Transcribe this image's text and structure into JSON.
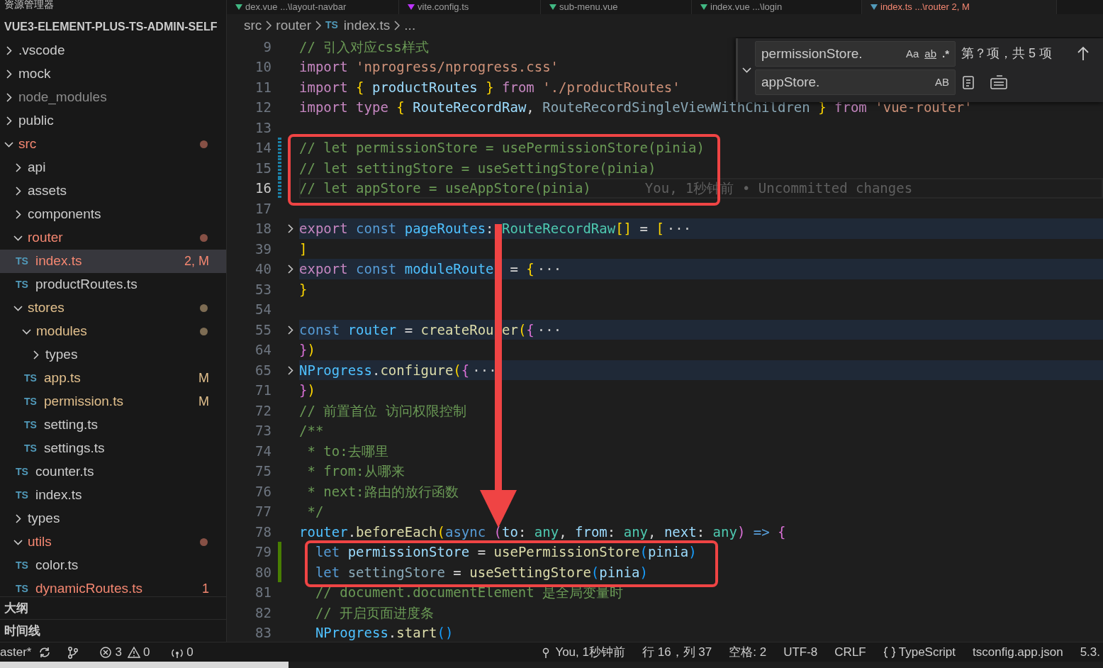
{
  "sidebar": {
    "title": "资源管理器",
    "project": "VUE3-ELEMENT-PLUS-TS-ADMIN-SELF",
    "tree": [
      {
        "label": ".vscode",
        "kind": "folder",
        "expanded": false
      },
      {
        "label": "mock",
        "kind": "folder",
        "expanded": false
      },
      {
        "label": "node_modules",
        "kind": "folder",
        "expanded": false,
        "color": "#8c8c8c"
      },
      {
        "label": "public",
        "kind": "folder",
        "expanded": false
      },
      {
        "label": "src",
        "kind": "folder",
        "expanded": true,
        "color": "#f48771",
        "dot": true,
        "children": [
          {
            "label": "api",
            "kind": "folder",
            "expanded": false
          },
          {
            "label": "assets",
            "kind": "folder",
            "expanded": false
          },
          {
            "label": "components",
            "kind": "folder",
            "expanded": false
          },
          {
            "label": "router",
            "kind": "folder",
            "expanded": true,
            "color": "#f48771",
            "dot": true,
            "children": [
              {
                "label": "index.ts",
                "kind": "file",
                "icon": "TS",
                "color": "#f48771",
                "badge": "2, M",
                "selected": true
              },
              {
                "label": "productRoutes.ts",
                "kind": "file",
                "icon": "TS",
                "selected": false
              }
            ]
          },
          {
            "label": "stores",
            "kind": "folder",
            "expanded": true,
            "color": "#e2c08d",
            "dot": true,
            "children": [
              {
                "label": "modules",
                "kind": "folder",
                "expanded": true,
                "color": "#e2c08d",
                "dot": true,
                "children": [
                  {
                    "label": "types",
                    "kind": "folder",
                    "expanded": false
                  },
                  {
                    "label": "app.ts",
                    "kind": "file",
                    "icon": "TS",
                    "color": "#e2c08d",
                    "badge": "M",
                    "selected": false
                  },
                  {
                    "label": "permission.ts",
                    "kind": "file",
                    "icon": "TS",
                    "color": "#e2c08d",
                    "badge": "M",
                    "selected": false
                  },
                  {
                    "label": "setting.ts",
                    "kind": "file",
                    "icon": "TS",
                    "selected": false
                  },
                  {
                    "label": "settings.ts",
                    "kind": "file",
                    "icon": "TS",
                    "selected": false
                  }
                ]
              },
              {
                "label": "counter.ts",
                "kind": "file",
                "icon": "TS",
                "selected": false
              },
              {
                "label": "index.ts",
                "kind": "file",
                "icon": "TS",
                "selected": false
              }
            ]
          },
          {
            "label": "types",
            "kind": "folder",
            "expanded": false
          },
          {
            "label": "utils",
            "kind": "folder",
            "expanded": true,
            "color": "#f48771",
            "dot": true,
            "children": [
              {
                "label": "color.ts",
                "kind": "file",
                "icon": "TS",
                "selected": false
              },
              {
                "label": "dynamicRoutes.ts",
                "kind": "file",
                "icon": "TS",
                "color": "#f48771",
                "badge": "1",
                "selected": false
              }
            ]
          }
        ]
      }
    ],
    "sections": [
      "大纲",
      "时间线"
    ]
  },
  "tabs": [
    {
      "label": "dex.vue",
      "desc": "...\\layout-navbar",
      "kind": "vue",
      "selected": false
    },
    {
      "label": "vite.config.ts",
      "kind": "vite",
      "selected": false
    },
    {
      "label": "sub-menu.vue",
      "kind": "vue",
      "selected": false
    },
    {
      "label": "index.vue",
      "desc": "...\\login",
      "kind": "vue",
      "selected": false
    },
    {
      "label": "index.ts",
      "desc": "...\\router",
      "badge": "2, M",
      "kind": "ts",
      "selected": true
    }
  ],
  "breadcrumbs": [
    {
      "label": "src"
    },
    {
      "label": "router"
    },
    {
      "label": "index.ts",
      "icon": "TS"
    },
    {
      "label": "..."
    }
  ],
  "find_widget": {
    "expanded": true,
    "find": "permissionStore.",
    "replace": "appStore.",
    "toggles": [
      {
        "label": "Aa",
        "on": false
      },
      {
        "label": "ab",
        "on": false
      },
      {
        "label": ".*",
        "on": false
      }
    ],
    "result": "第？项，共 5 项",
    "preserve_case": {
      "label": "AB",
      "on": false
    }
  },
  "lines": [
    {
      "num": "9",
      "tokens": [
        {
          "text": "// 引入对应css样式",
          "kind": "cmt"
        }
      ]
    },
    {
      "num": "10",
      "tokens": [
        {
          "text": "import ",
          "kind": "kw"
        },
        {
          "text": "'nprogress/nprogress.css'",
          "kind": "str"
        }
      ]
    },
    {
      "num": "11",
      "tokens": [
        {
          "text": "import ",
          "kind": "kw"
        },
        {
          "text": "{",
          "kind": "b1"
        },
        {
          "text": " productRoutes ",
          "kind": "var"
        },
        {
          "text": "}",
          "kind": "b1"
        },
        {
          "text": " from ",
          "kind": "kw"
        },
        {
          "text": "'./productRoutes'",
          "kind": "str"
        }
      ]
    },
    {
      "num": "12",
      "tokens": [
        {
          "text": "import ",
          "kind": "kw"
        },
        {
          "text": "type ",
          "kind": "kw"
        },
        {
          "text": "{",
          "kind": "b1"
        },
        {
          "text": " RouteRecordRaw",
          "kind": "var"
        },
        {
          "text": ", ",
          "kind": "p"
        },
        {
          "text": "RouteRecordSingleViewWithChildren ",
          "kind": "unused"
        },
        {
          "text": "}",
          "kind": "b1"
        },
        {
          "text": " from ",
          "kind": "kw"
        },
        {
          "text": "'vue-router'",
          "kind": "str"
        }
      ]
    },
    {
      "num": "13"
    },
    {
      "num": "14",
      "kind": "modified",
      "tokens": [
        {
          "text": "// let permissionStore = usePermissionStore(pinia)",
          "kind": "cmt"
        }
      ]
    },
    {
      "num": "15",
      "kind": "modified",
      "tokens": [
        {
          "text": "// let settingStore = useSettingStore(pinia)",
          "kind": "cmt"
        }
      ]
    },
    {
      "num": "16",
      "kind": "modified",
      "current": true,
      "tokens": [
        {
          "text": "// let appStore = useAppStore(pinia)",
          "kind": "cmt"
        }
      ],
      "blame": "You, 1秒钟前 • Uncommitted changes"
    },
    {
      "num": "17"
    },
    {
      "num": "18",
      "folded": true,
      "tokens": [
        {
          "text": "export ",
          "kind": "kw"
        },
        {
          "text": "const ",
          "kind": "st"
        },
        {
          "text": "pageRoutes",
          "kind": "cvar"
        },
        {
          "text": ": ",
          "kind": "p"
        },
        {
          "text": "RouteRecordRaw",
          "kind": "typ"
        },
        {
          "text": "[]",
          "kind": "b1"
        },
        {
          "text": " = ",
          "kind": "p"
        },
        {
          "text": "[",
          "kind": "b1"
        },
        {
          "text": "···",
          "kind": "fold"
        }
      ]
    },
    {
      "num": "39",
      "tokens": [
        {
          "text": "]",
          "kind": "b1"
        }
      ]
    },
    {
      "num": "40",
      "folded": true,
      "tokens": [
        {
          "text": "export ",
          "kind": "kw"
        },
        {
          "text": "const ",
          "kind": "st"
        },
        {
          "text": "moduleRoute",
          "kind": "cvar"
        },
        {
          "text": "  = ",
          "kind": "p"
        },
        {
          "text": "{",
          "kind": "b1"
        },
        {
          "text": "···",
          "kind": "fold"
        }
      ]
    },
    {
      "num": "53",
      "tokens": [
        {
          "text": "}",
          "kind": "b1"
        }
      ]
    },
    {
      "num": "54"
    },
    {
      "num": "55",
      "folded": true,
      "tokens": [
        {
          "text": "const ",
          "kind": "st"
        },
        {
          "text": "router",
          "kind": "cvar"
        },
        {
          "text": " = ",
          "kind": "p"
        },
        {
          "text": "createRou",
          "kind": "fn"
        },
        {
          "text": " er",
          "kind": "fn"
        },
        {
          "text": "(",
          "kind": "b1"
        },
        {
          "text": "{",
          "kind": "b2"
        },
        {
          "text": "···",
          "kind": "fold"
        }
      ]
    },
    {
      "num": "64",
      "tokens": [
        {
          "text": "}",
          "kind": "b2"
        },
        {
          "text": ")",
          "kind": "b1"
        }
      ]
    },
    {
      "num": "65",
      "folded": true,
      "tokens": [
        {
          "text": "NProgress",
          "kind": "cvar"
        },
        {
          "text": ".",
          "kind": "p"
        },
        {
          "text": "configure",
          "kind": "fn"
        },
        {
          "text": "(",
          "kind": "b1"
        },
        {
          "text": "{",
          "kind": "b2"
        },
        {
          "text": "···",
          "kind": "fold"
        }
      ]
    },
    {
      "num": "71",
      "tokens": [
        {
          "text": "}",
          "kind": "b2"
        },
        {
          "text": ")",
          "kind": "b1"
        }
      ]
    },
    {
      "num": "72",
      "tokens": [
        {
          "text": "// 前置首位 访问权限控制",
          "kind": "cmt"
        }
      ]
    },
    {
      "num": "73",
      "tokens": [
        {
          "text": "/**",
          "kind": "cmt"
        }
      ]
    },
    {
      "num": "74",
      "tokens": [
        {
          "text": " * to:去哪里",
          "kind": "cmt"
        }
      ]
    },
    {
      "num": "75",
      "tokens": [
        {
          "text": " * from:从哪来",
          "kind": "cmt"
        }
      ]
    },
    {
      "num": "76",
      "tokens": [
        {
          "text": " * next:路由的放行函数",
          "kind": "cmt"
        }
      ]
    },
    {
      "num": "77",
      "tokens": [
        {
          "text": " */",
          "kind": "cmt"
        }
      ]
    },
    {
      "num": "78",
      "tokens": [
        {
          "text": "router",
          "kind": "cvar"
        },
        {
          "text": ".",
          "kind": "p"
        },
        {
          "text": "beforeEach",
          "kind": "fn"
        },
        {
          "text": "(",
          "kind": "b1"
        },
        {
          "text": "async ",
          "kind": "st"
        },
        {
          "text": "(",
          "kind": "b2"
        },
        {
          "text": "to",
          "kind": "var"
        },
        {
          "text": ": ",
          "kind": "p"
        },
        {
          "text": "any",
          "kind": "typ"
        },
        {
          "text": ", ",
          "kind": "p"
        },
        {
          "text": "from",
          "kind": "var"
        },
        {
          "text": ": ",
          "kind": "p"
        },
        {
          "text": "any",
          "kind": "typ"
        },
        {
          "text": ", ",
          "kind": "p"
        },
        {
          "text": "next",
          "kind": "var"
        },
        {
          "text": ": ",
          "kind": "p"
        },
        {
          "text": "any",
          "kind": "typ"
        },
        {
          "text": ")",
          "kind": "b2"
        },
        {
          "text": " => ",
          "kind": "st"
        },
        {
          "text": "{",
          "kind": "b2"
        }
      ]
    },
    {
      "num": "79",
      "kind": "added",
      "tokens": [
        {
          "text": "  let ",
          "kind": "st"
        },
        {
          "text": "permissionStore",
          "kind": "var"
        },
        {
          "text": " = ",
          "kind": "p"
        },
        {
          "text": "usePermissionStore",
          "kind": "fn"
        },
        {
          "text": "(",
          "kind": "b3"
        },
        {
          "text": "pinia",
          "kind": "var"
        },
        {
          "text": ")",
          "kind": "b3"
        }
      ]
    },
    {
      "num": "80",
      "kind": "added",
      "tokens": [
        {
          "text": "  let ",
          "kind": "st"
        },
        {
          "text": "settingStore",
          "kind": "unused"
        },
        {
          "text": " = ",
          "kind": "p"
        },
        {
          "text": "useSettingStore",
          "kind": "fn"
        },
        {
          "text": "(",
          "kind": "b3"
        },
        {
          "text": "pinia",
          "kind": "var"
        },
        {
          "text": ")",
          "kind": "b3"
        }
      ]
    },
    {
      "num": "81",
      "tokens": [
        {
          "text": "  // document.documentElement 是全局变量时",
          "kind": "cmt"
        }
      ]
    },
    {
      "num": "82",
      "tokens": [
        {
          "text": "  // 开启页面进度条",
          "kind": "cmt"
        }
      ]
    },
    {
      "num": "83",
      "tokens": [
        {
          "text": "  NProgress",
          "kind": "cvar"
        },
        {
          "text": ".",
          "kind": "p"
        },
        {
          "text": "start",
          "kind": "fn"
        },
        {
          "text": "()",
          "kind": "b3"
        }
      ]
    }
  ],
  "status_bar": {
    "left": [
      {
        "kind": "branch",
        "text": "aster*"
      },
      {
        "kind": "sync"
      },
      {
        "kind": "graph"
      },
      {
        "kind": "errors",
        "text": "3"
      },
      {
        "kind": "warnings",
        "text": "0"
      },
      {
        "kind": "ports",
        "text": "0"
      }
    ],
    "right": [
      {
        "kind": "blame",
        "text": "You, 1秒钟前"
      },
      {
        "kind": "text",
        "text": "行 16，列 37"
      },
      {
        "kind": "text",
        "text": "空格: 2"
      },
      {
        "kind": "text",
        "text": "UTF-8"
      },
      {
        "kind": "text",
        "text": "CRLF"
      },
      {
        "kind": "language",
        "text": "TypeScript"
      },
      {
        "kind": "text",
        "text": "tsconfig.app.json"
      },
      {
        "kind": "text",
        "text": "5.3."
      }
    ]
  }
}
